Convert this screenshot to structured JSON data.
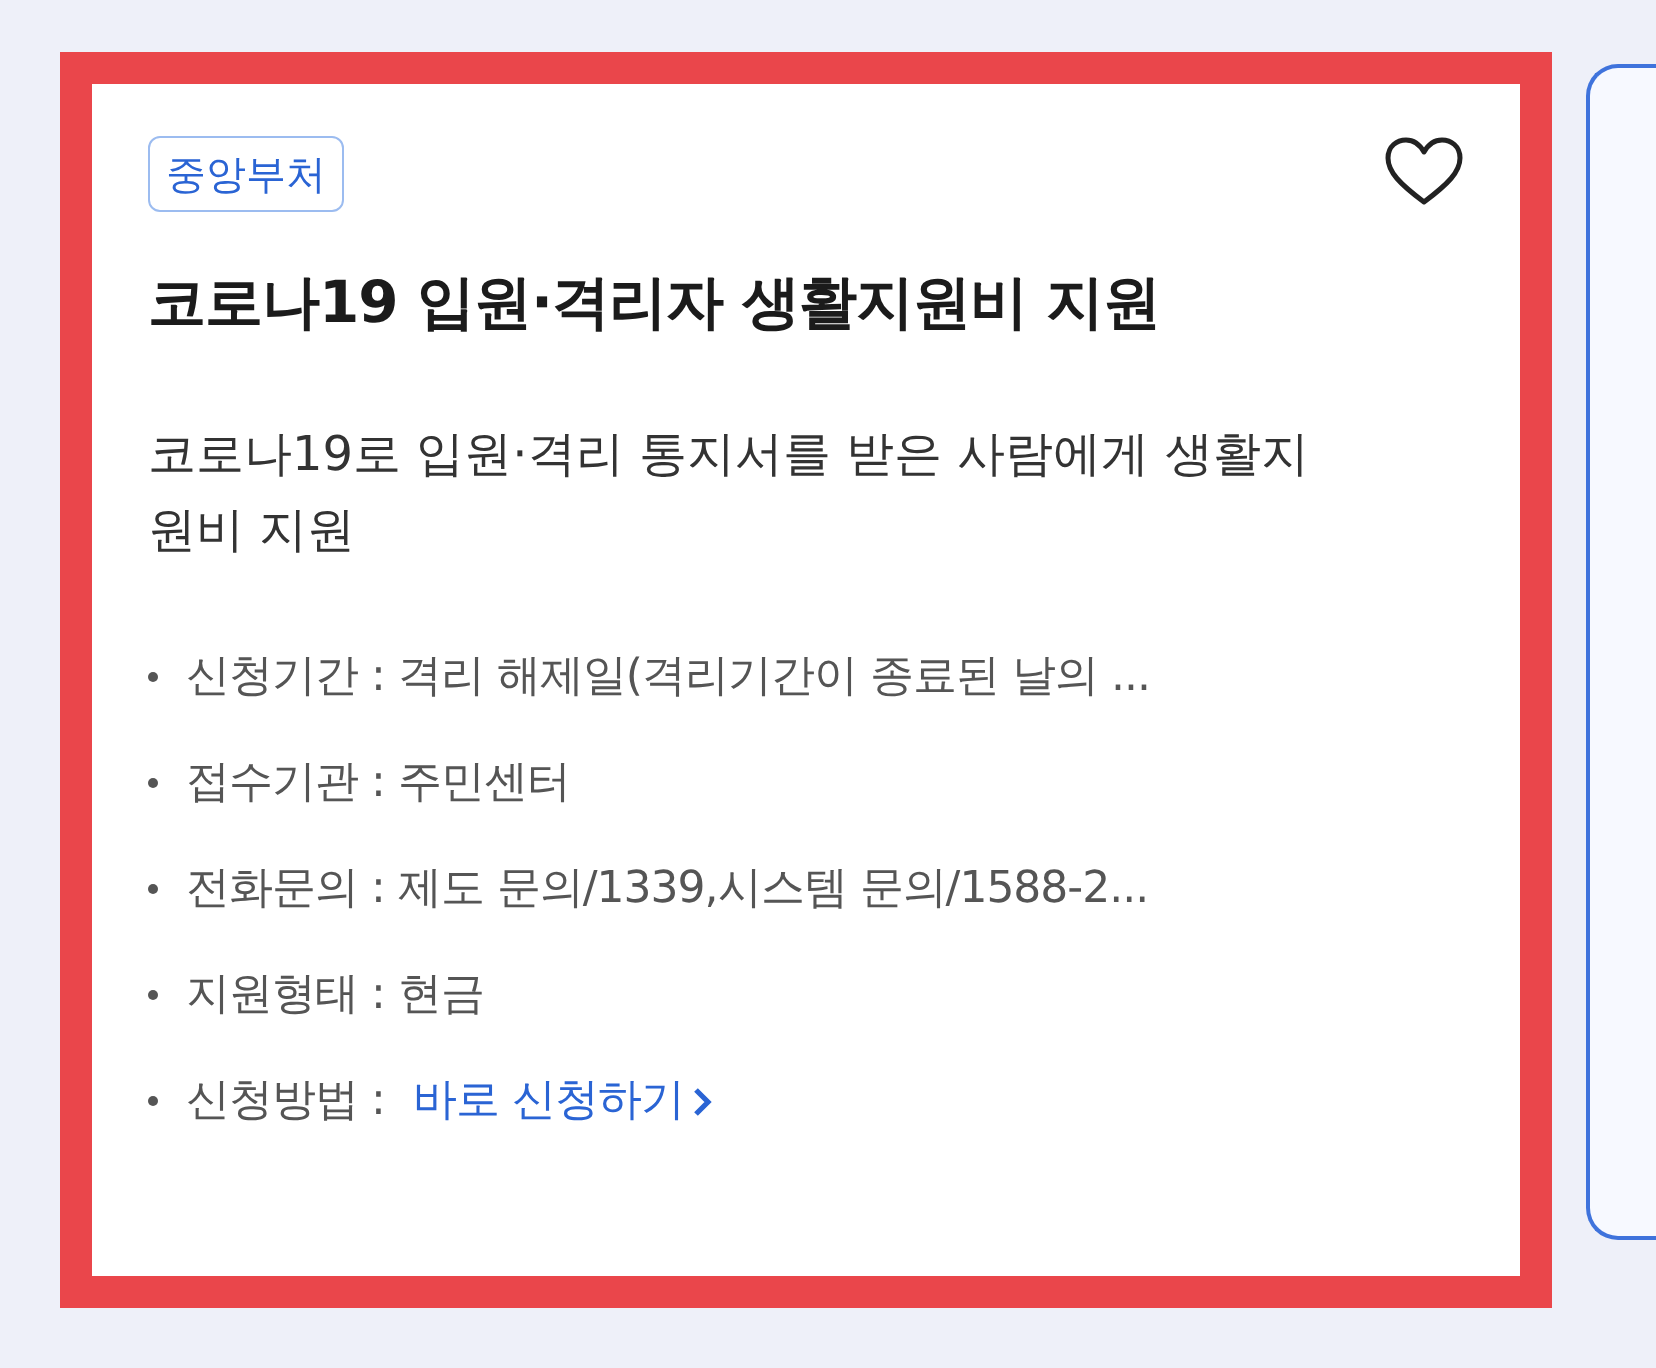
{
  "card": {
    "highlighted": true,
    "tag": "중앙부처",
    "favorite": false,
    "title": "코로나19 입원·격리자 생활지원비 지원",
    "description": "코로나19로 입원·격리 통지서를 받은 사람에게 생활지원비 지원",
    "details": [
      {
        "kind": "text",
        "text": "신청기간 : 격리 해제일(격리기간이 종료된 날의 ..."
      },
      {
        "kind": "text",
        "text": "접수기관 : 주민센터"
      },
      {
        "kind": "text",
        "text": "전화문의 : 제도 문의/1339,시스템 문의/1588-2..."
      },
      {
        "kind": "text",
        "text": "지원형태 : 현금"
      },
      {
        "kind": "link",
        "text": "신청방법 :",
        "link": "바로 신청하기"
      }
    ]
  }
}
